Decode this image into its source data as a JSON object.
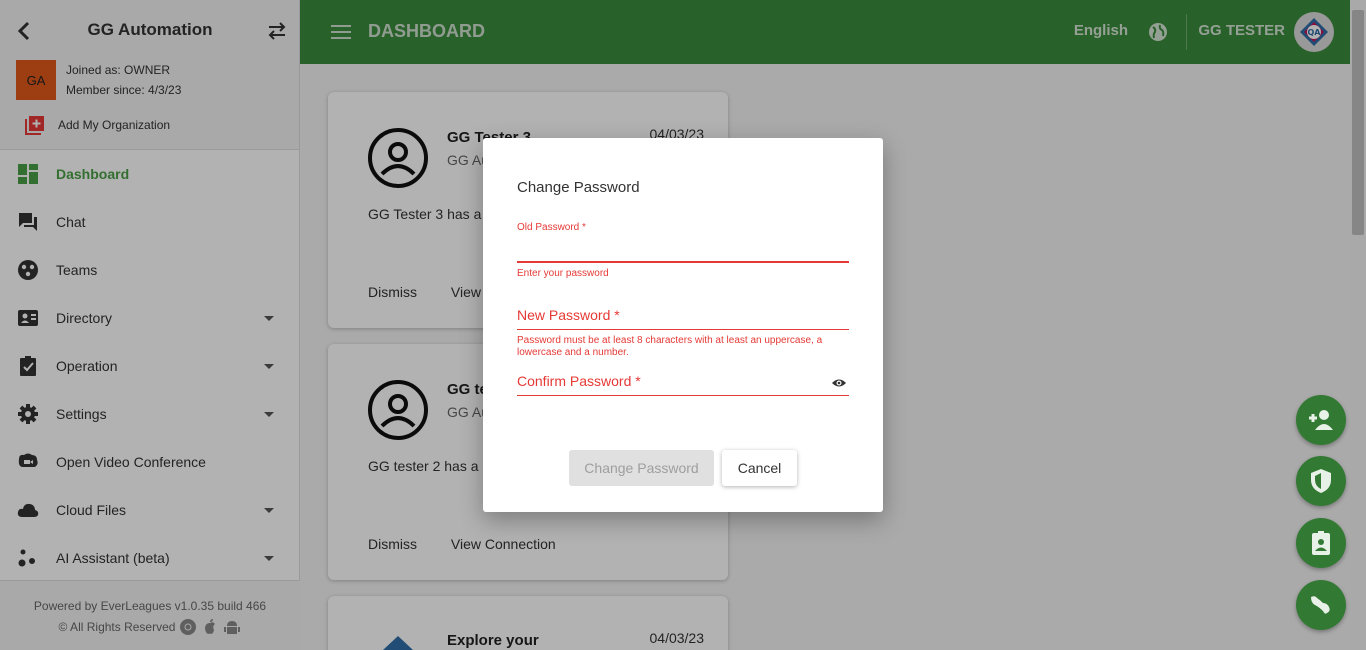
{
  "sidebar": {
    "org_name": "GG Automation",
    "org_initials": "GA",
    "joined": "Joined as: OWNER",
    "member_since": "Member since: 4/3/23",
    "add_org": "Add My Organization",
    "items": [
      {
        "label": "Dashboard",
        "icon": "dashboard-icon",
        "active": true
      },
      {
        "label": "Chat",
        "icon": "chat-icon"
      },
      {
        "label": "Teams",
        "icon": "teams-icon"
      },
      {
        "label": "Directory",
        "icon": "directory-icon",
        "expandable": true
      },
      {
        "label": "Operation",
        "icon": "operation-icon",
        "expandable": true
      },
      {
        "label": "Settings",
        "icon": "gear-icon",
        "expandable": true
      },
      {
        "label": "Open Video Conference",
        "icon": "video-conference-icon"
      },
      {
        "label": "Cloud Files",
        "icon": "cloud-icon",
        "expandable": true
      },
      {
        "label": "AI Assistant (beta)",
        "icon": "ai-assistant-icon",
        "expandable": true
      }
    ],
    "powered": "Powered by EverLeagues v1.0.35 build 466",
    "rights": "© All Rights Reserved"
  },
  "topbar": {
    "title": "DASHBOARD",
    "language": "English",
    "user_name": "GG TESTER"
  },
  "cards": [
    {
      "name": "GG Tester 3",
      "org": "GG Au",
      "date": "04/03/23",
      "message": "GG Tester 3 has a                             GG Automation.",
      "dismiss": "Dismiss",
      "view": "View"
    },
    {
      "name": "GG te",
      "org": "GG Au",
      "date": "",
      "message": "GG tester 2 has a                             GG Automation.",
      "dismiss": "Dismiss",
      "view": "View Connection"
    },
    {
      "name": "Explore your",
      "date": "04/03/23"
    }
  ],
  "modal": {
    "title": "Change Password",
    "old_password_label": "Old Password *",
    "old_password_error": "Enter your password",
    "new_password_label": "New Password *",
    "new_password_help": "Password must be at least 8 characters with at least an uppercase, a lowercase and a number.",
    "confirm_password_label": "Confirm Password *",
    "submit_label": "Change Password",
    "cancel_label": "Cancel"
  },
  "colors": {
    "brand_green": "#3c8b3d",
    "active_green": "#4a9f45",
    "error_red": "#e53935",
    "org_avatar": "#e05a1b"
  },
  "fabs": [
    "add-contact-icon",
    "shield-icon",
    "clipboard-user-icon",
    "map-icon"
  ]
}
